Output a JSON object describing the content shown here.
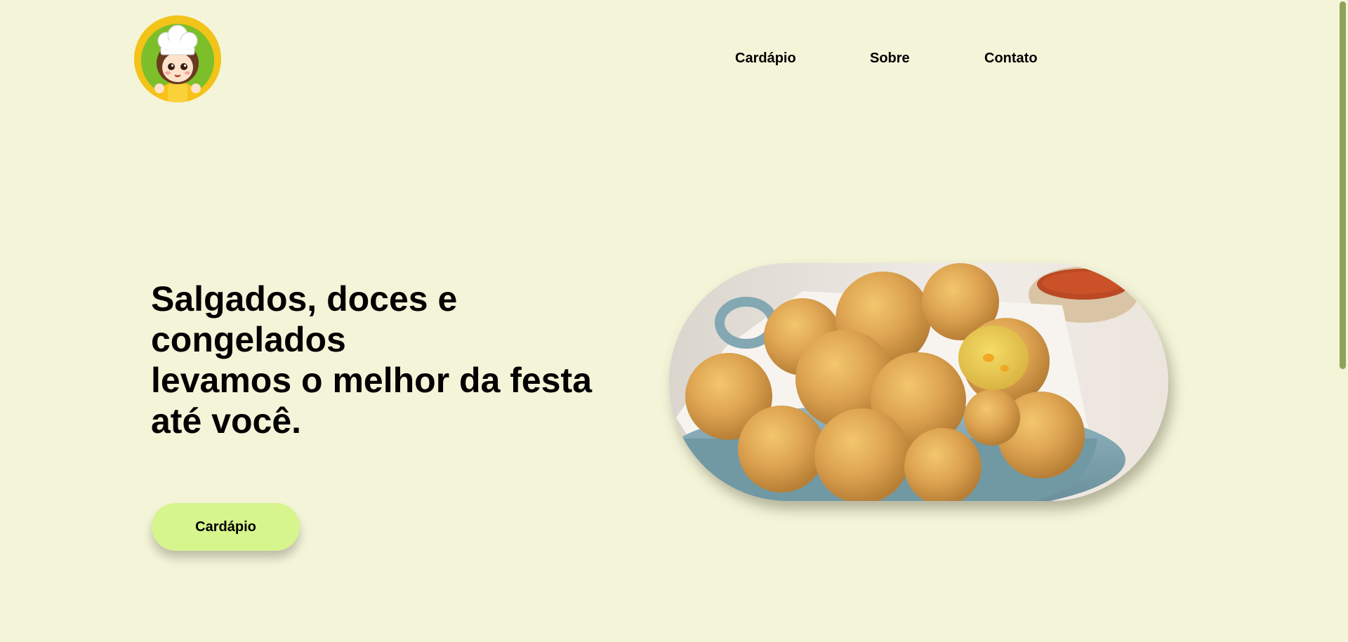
{
  "header": {
    "logo_icon": "chef-girl-logo-icon",
    "nav": [
      {
        "label": "Cardápio"
      },
      {
        "label": "Sobre"
      },
      {
        "label": "Contato"
      }
    ]
  },
  "hero": {
    "title_lines": [
      "Salgados, doces e congelados",
      "levamos o melhor da festa até você."
    ],
    "cta_label": "Cardápio",
    "image_icon": "fried-croquettes-bowl-image"
  },
  "colors": {
    "background": "#f4f4d9",
    "cta": "#d6f58c",
    "logo_ring": "#f2c318",
    "scrollbar_thumb": "#8ea25a"
  }
}
